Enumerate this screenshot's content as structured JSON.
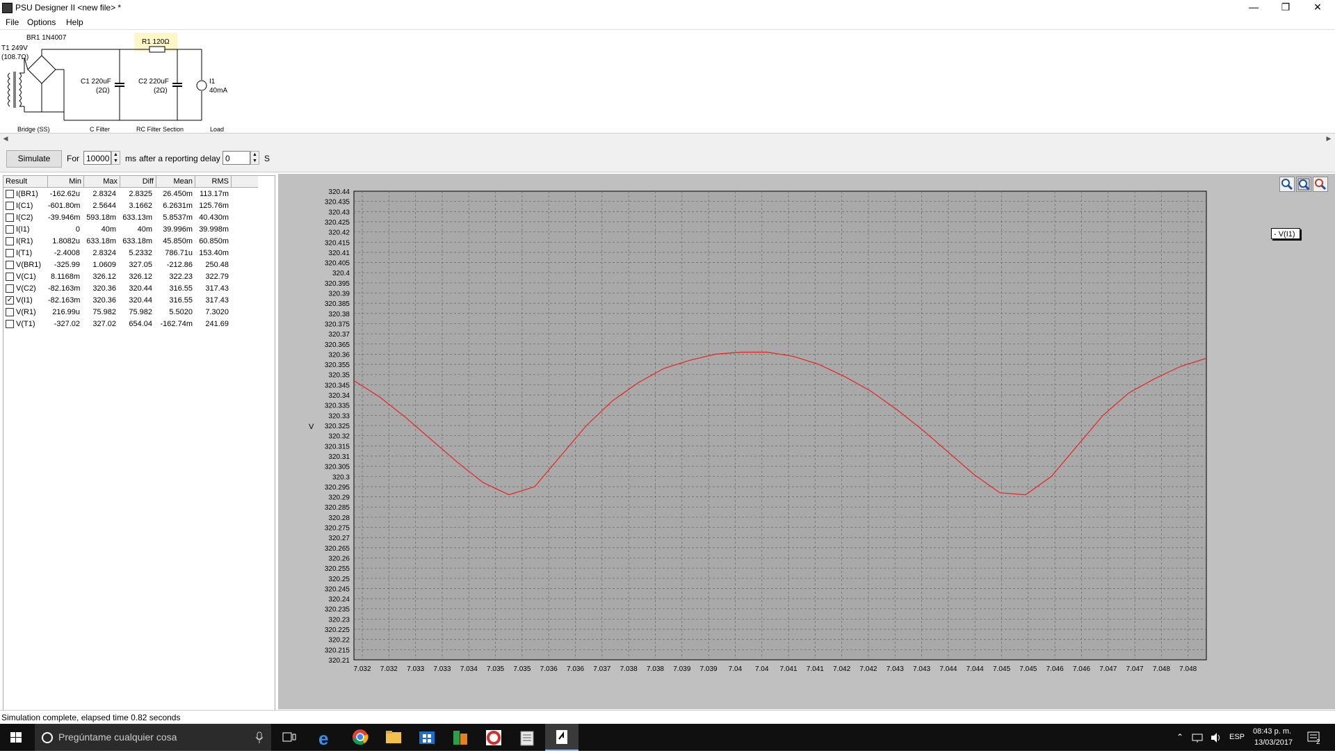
{
  "window": {
    "title": "PSU Designer II  <new file> *",
    "controls": [
      "minimize-icon",
      "restore-icon",
      "close-icon"
    ]
  },
  "menu": {
    "items": [
      "File",
      "Options",
      "Help"
    ]
  },
  "schematic": {
    "transformer": {
      "name": "T1 249V",
      "resistance": "(108.7Ω)"
    },
    "bridge": "BR1 1N4007",
    "r1": "R1 120Ω",
    "c1": {
      "name": "C1 220uF",
      "esr": "(2Ω)"
    },
    "c2": {
      "name": "C2 220uF",
      "esr": "(2Ω)"
    },
    "load": {
      "name": "I1",
      "value": "40mA"
    },
    "sections": [
      "Bridge (SS)",
      "C Filter",
      "RC Filter Section",
      "Load"
    ]
  },
  "toolbar": {
    "simulate_label": "Simulate",
    "for_label": "For",
    "duration_value": "10000",
    "ms_label": "ms",
    "delay_label": "after a reporting delay of",
    "delay_value": "0",
    "s_label": "S"
  },
  "results": {
    "columns": [
      "Result",
      "Min",
      "Max",
      "Diff",
      "Mean",
      "RMS"
    ],
    "rows": [
      {
        "checked": false,
        "name": "I(BR1)",
        "min": "-162.62u",
        "max": "2.8324",
        "diff": "2.8325",
        "mean": "26.450m",
        "rms": "113.17m"
      },
      {
        "checked": false,
        "name": "I(C1)",
        "min": "-601.80m",
        "max": "2.5644",
        "diff": "3.1662",
        "mean": "6.2631m",
        "rms": "125.76m"
      },
      {
        "checked": false,
        "name": "I(C2)",
        "min": "-39.946m",
        "max": "593.18m",
        "diff": "633.13m",
        "mean": "5.8537m",
        "rms": "40.430m"
      },
      {
        "checked": false,
        "name": "I(I1)",
        "min": "0",
        "max": "40m",
        "diff": "40m",
        "mean": "39.996m",
        "rms": "39.998m"
      },
      {
        "checked": false,
        "name": "I(R1)",
        "min": "1.8082u",
        "max": "633.18m",
        "diff": "633.18m",
        "mean": "45.850m",
        "rms": "60.850m"
      },
      {
        "checked": false,
        "name": "I(T1)",
        "min": "-2.4008",
        "max": "2.8324",
        "diff": "5.2332",
        "mean": "786.71u",
        "rms": "153.40m"
      },
      {
        "checked": false,
        "name": "V(BR1)",
        "min": "-325.99",
        "max": "1.0609",
        "diff": "327.05",
        "mean": "-212.86",
        "rms": "250.48"
      },
      {
        "checked": false,
        "name": "V(C1)",
        "min": "8.1168m",
        "max": "326.12",
        "diff": "326.12",
        "mean": "322.23",
        "rms": "322.79"
      },
      {
        "checked": false,
        "name": "V(C2)",
        "min": "-82.163m",
        "max": "320.36",
        "diff": "320.44",
        "mean": "316.55",
        "rms": "317.43"
      },
      {
        "checked": true,
        "name": "V(I1)",
        "min": "-82.163m",
        "max": "320.36",
        "diff": "320.44",
        "mean": "316.55",
        "rms": "317.43"
      },
      {
        "checked": false,
        "name": "V(R1)",
        "min": "216.99u",
        "max": "75.982",
        "diff": "75.982",
        "mean": "5.5020",
        "rms": "7.3020"
      },
      {
        "checked": false,
        "name": "V(T1)",
        "min": "-327.02",
        "max": "327.02",
        "diff": "654.04",
        "mean": "-162.74m",
        "rms": "241.69"
      }
    ]
  },
  "plot": {
    "zoom_buttons": [
      "zoom-in-icon",
      "zoom-fit-icon",
      "zoom-out-icon"
    ],
    "legend": "- V(I1)",
    "series_color": "#e8231e",
    "background": "#c0c0c0",
    "plot_background": "#a9a9a9"
  },
  "chart_data": {
    "type": "line",
    "ylabel": "V",
    "ylim": [
      320.21,
      320.44
    ],
    "xlim": [
      7.032,
      7.0485
    ],
    "y_ticks": [
      "320.44",
      "320.435",
      "320.43",
      "320.425",
      "320.42",
      "320.415",
      "320.41",
      "320.405",
      "320.4",
      "320.395",
      "320.39",
      "320.385",
      "320.38",
      "320.375",
      "320.37",
      "320.365",
      "320.36",
      "320.355",
      "320.35",
      "320.345",
      "320.34",
      "320.335",
      "320.33",
      "320.325",
      "320.32",
      "320.315",
      "320.31",
      "320.305",
      "320.3",
      "320.295",
      "320.29",
      "320.285",
      "320.28",
      "320.275",
      "320.27",
      "320.265",
      "320.26",
      "320.255",
      "320.25",
      "320.245",
      "320.24",
      "320.235",
      "320.23",
      "320.225",
      "320.22",
      "320.215",
      "320.21"
    ],
    "x_ticks": [
      "7.032",
      "7.032",
      "7.033",
      "7.033",
      "7.034",
      "7.035",
      "7.035",
      "7.036",
      "7.036",
      "7.037",
      "7.038",
      "7.038",
      "7.039",
      "7.039",
      "7.04",
      "7.04",
      "7.041",
      "7.041",
      "7.042",
      "7.042",
      "7.043",
      "7.043",
      "7.044",
      "7.044",
      "7.045",
      "7.045",
      "7.046",
      "7.046",
      "7.047",
      "7.047",
      "7.048",
      "7.048"
    ],
    "grid": true,
    "series": [
      {
        "name": "V(I1)",
        "x": [
          7.032,
          7.0325,
          7.033,
          7.0335,
          7.034,
          7.0345,
          7.035,
          7.0355,
          7.036,
          7.0365,
          7.037,
          7.0375,
          7.038,
          7.0385,
          7.039,
          7.0395,
          7.04,
          7.0405,
          7.041,
          7.0415,
          7.042,
          7.0425,
          7.043,
          7.0435,
          7.044,
          7.0445,
          7.045,
          7.0455,
          7.046,
          7.0465,
          7.047,
          7.0475,
          7.048,
          7.0485
        ],
        "y": [
          320.347,
          320.339,
          320.329,
          320.318,
          320.307,
          320.297,
          320.291,
          320.295,
          320.31,
          320.325,
          320.337,
          320.346,
          320.353,
          320.357,
          320.36,
          320.361,
          320.361,
          320.359,
          320.355,
          320.349,
          320.342,
          320.333,
          320.323,
          320.312,
          320.301,
          320.292,
          320.291,
          320.3,
          320.315,
          320.33,
          320.341,
          320.348,
          320.354,
          320.358
        ]
      }
    ]
  },
  "status": {
    "text": "Simulation complete, elapsed time 0.82 seconds"
  },
  "taskbar": {
    "search_placeholder": "Pregúntame cualquier cosa",
    "apps": [
      "task-view-icon",
      "edge-icon",
      "chrome-icon",
      "file-explorer-icon",
      "store-icon",
      "office-icon",
      "ccleaner-icon",
      "notepad-icon",
      "psu-designer-icon"
    ],
    "language": "ESP",
    "time": "08:43 p. m.",
    "date": "13/03/2017",
    "notifications": "2"
  }
}
